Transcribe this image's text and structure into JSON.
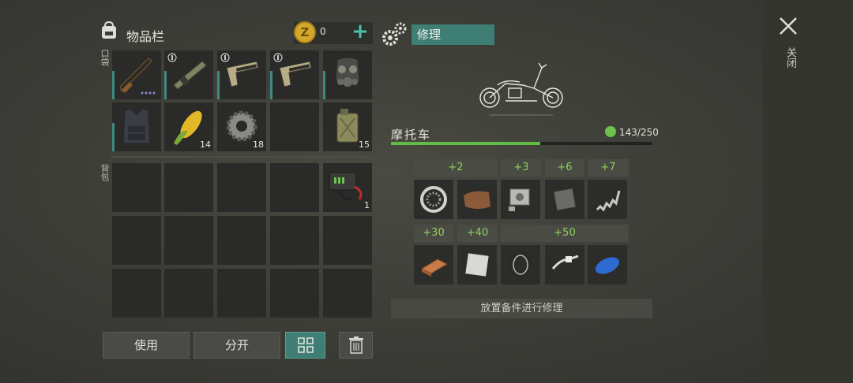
{
  "inventory": {
    "title": "物品栏",
    "coins": "0",
    "coin_symbol": "Z",
    "pockets_label": "口袋",
    "backpack_label": "背包",
    "pockets": [
      {
        "icon": "rifle-icon",
        "count": ""
      },
      {
        "icon": "rocket-launcher-icon",
        "count": ""
      },
      {
        "icon": "pistol-icon",
        "count": ""
      },
      {
        "icon": "pistol-icon",
        "count": ""
      },
      {
        "icon": "gas-mask-icon",
        "count": ""
      },
      {
        "icon": "armor-vest-icon",
        "count": ""
      },
      {
        "icon": "corn-icon",
        "count": "14"
      },
      {
        "icon": "gear-part-icon",
        "count": "18"
      },
      {
        "icon": "empty",
        "count": ""
      },
      {
        "icon": "jerrycan-icon",
        "count": "15"
      }
    ],
    "backpack": [
      {
        "icon": "empty",
        "count": ""
      },
      {
        "icon": "empty",
        "count": ""
      },
      {
        "icon": "empty",
        "count": ""
      },
      {
        "icon": "empty",
        "count": ""
      },
      {
        "icon": "car-battery-icon",
        "count": "1"
      },
      {
        "icon": "empty",
        "count": ""
      },
      {
        "icon": "empty",
        "count": ""
      },
      {
        "icon": "empty",
        "count": ""
      },
      {
        "icon": "empty",
        "count": ""
      },
      {
        "icon": "empty",
        "count": ""
      },
      {
        "icon": "empty",
        "count": ""
      },
      {
        "icon": "empty",
        "count": ""
      },
      {
        "icon": "empty",
        "count": ""
      },
      {
        "icon": "empty",
        "count": ""
      },
      {
        "icon": "empty",
        "count": ""
      }
    ],
    "buttons": {
      "use": "使用",
      "split": "分开"
    }
  },
  "repair": {
    "tab_label": "修理",
    "item_name": "摩托车",
    "durability_text": "143/250",
    "durability_fraction": 0.572,
    "bonuses_row1": [
      "+2",
      "+3",
      "+6",
      "+7"
    ],
    "bonuses_row2": [
      "+30",
      "+40",
      "+50"
    ],
    "parts_row1": [
      "bearing-icon",
      "leather-icon",
      "engine-block-icon",
      "metal-plate-icon",
      "spring-icon"
    ],
    "parts_row2": [
      "copper-ingot-icon",
      "steel-sheet-icon",
      "wheel-icon",
      "brake-lever-icon",
      "fuel-tank-icon"
    ],
    "hint": "放置备件进行修理"
  },
  "close_label": "关闭",
  "colors": {
    "accent": "#3e7e74",
    "durability": "#5fbd43",
    "bonus": "#8fd05a"
  }
}
